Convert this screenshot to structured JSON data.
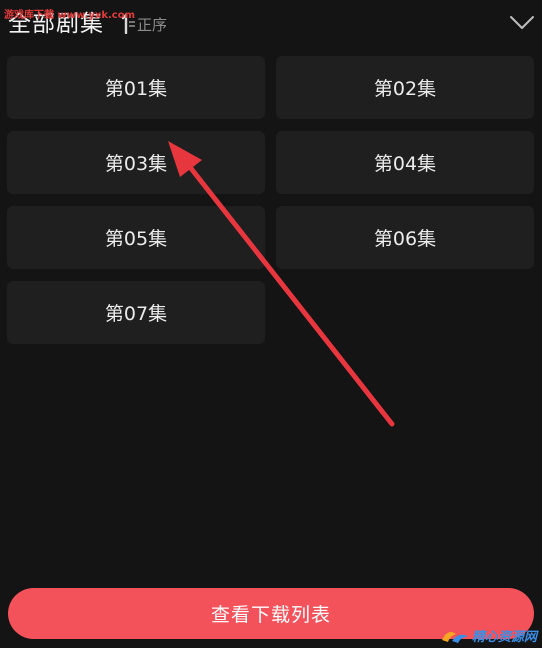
{
  "watermark": {
    "top_text": "游戏库下载 www.yxk.com",
    "logo_text": "精心资源网"
  },
  "header": {
    "title": "全部剧集",
    "sort_label": "正序",
    "sort_icon": "sort-order-icon",
    "collapse_icon": "chevron-down-icon"
  },
  "episodes": [
    {
      "label": "第01集"
    },
    {
      "label": "第02集"
    },
    {
      "label": "第03集"
    },
    {
      "label": "第04集"
    },
    {
      "label": "第05集"
    },
    {
      "label": "第06集"
    },
    {
      "label": "第07集"
    }
  ],
  "footer": {
    "download_list_label": "查看下载列表"
  },
  "annotation": {
    "arrow_color": "#e8363e"
  },
  "colors": {
    "background": "#141414",
    "tile": "#1f1f1f",
    "accent": "#f4525b",
    "muted_text": "#8c8c8c"
  }
}
